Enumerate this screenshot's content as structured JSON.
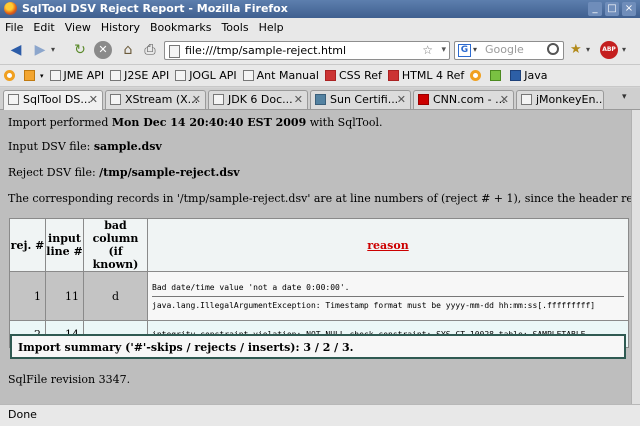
{
  "window": {
    "title": "SqlTool DSV Reject Report - Mozilla Firefox",
    "buttons": [
      "_",
      "□",
      "×"
    ]
  },
  "menu": [
    "File",
    "Edit",
    "View",
    "History",
    "Bookmarks",
    "Tools",
    "Help"
  ],
  "nav": {
    "url": "file:///tmp/sample-reject.html",
    "search_placeholder": "Google"
  },
  "bookmarks": [
    {
      "label": "",
      "icon": "ring-icon"
    },
    {
      "label": "",
      "icon": "rss-folder-icon"
    },
    {
      "label": "JME API",
      "icon": "page-icon"
    },
    {
      "label": "J2SE API",
      "icon": "page-icon"
    },
    {
      "label": "JOGL API",
      "icon": "page-icon"
    },
    {
      "label": "Ant Manual",
      "icon": "page-icon"
    },
    {
      "label": "CSS Ref",
      "icon": "w3c-icon"
    },
    {
      "label": "HTML 4 Ref",
      "icon": "w3c-icon"
    },
    {
      "label": "",
      "icon": "ring-icon"
    },
    {
      "label": "",
      "icon": "w3c-green-icon"
    },
    {
      "label": "Java",
      "icon": "java-icon"
    }
  ],
  "tabs": [
    {
      "label": "SqlTool DS...",
      "active": true
    },
    {
      "label": "XStream (X...",
      "active": false
    },
    {
      "label": "JDK 6 Doc...",
      "active": false
    },
    {
      "label": "Sun Certifi...",
      "active": false
    },
    {
      "label": "CNN.com - ...",
      "active": false
    },
    {
      "label": "jMonkeyEn...",
      "active": false
    }
  ],
  "page": {
    "import_prefix": "Import performed ",
    "import_date": "Mon Dec 14 20:40:40 EST 2009",
    "import_suffix": " with SqlTool.",
    "input_prefix": "Input DSV file: ",
    "input_file": "sample.dsv",
    "reject_prefix": "Reject DSV file: ",
    "reject_file": "/tmp/sample-reject.dsv",
    "correspond_text": "The corresponding records in '/tmp/sample-reject.dsv' are at line numbers of (reject # + 1), since the header record occupies the first line.",
    "table": {
      "headers": {
        "rej": "rej. #",
        "input": "input line #",
        "bad": "bad column (if known)",
        "reason": "reason"
      },
      "rows": [
        {
          "rej": "1",
          "line": "11",
          "column": "d",
          "msg1": "Bad date/time value 'not a date 0:00:00'.",
          "msg2": "java.lang.IllegalArgumentException: Timestamp format must be yyyy-mm-dd hh:mm:ss[.fffffffff]"
        },
        {
          "rej": "2",
          "line": "14",
          "column": "",
          "msg1": "integrity constraint violation: NOT NULL check constraint; SYS_CT_10028 table: SAMPLETABLE",
          "msg2": ""
        }
      ]
    },
    "summary": "Import summary ('#'-skips / rejects / inserts): 3 / 2 / 3.",
    "revision": "SqlFile revision 3347."
  },
  "status": "Done"
}
